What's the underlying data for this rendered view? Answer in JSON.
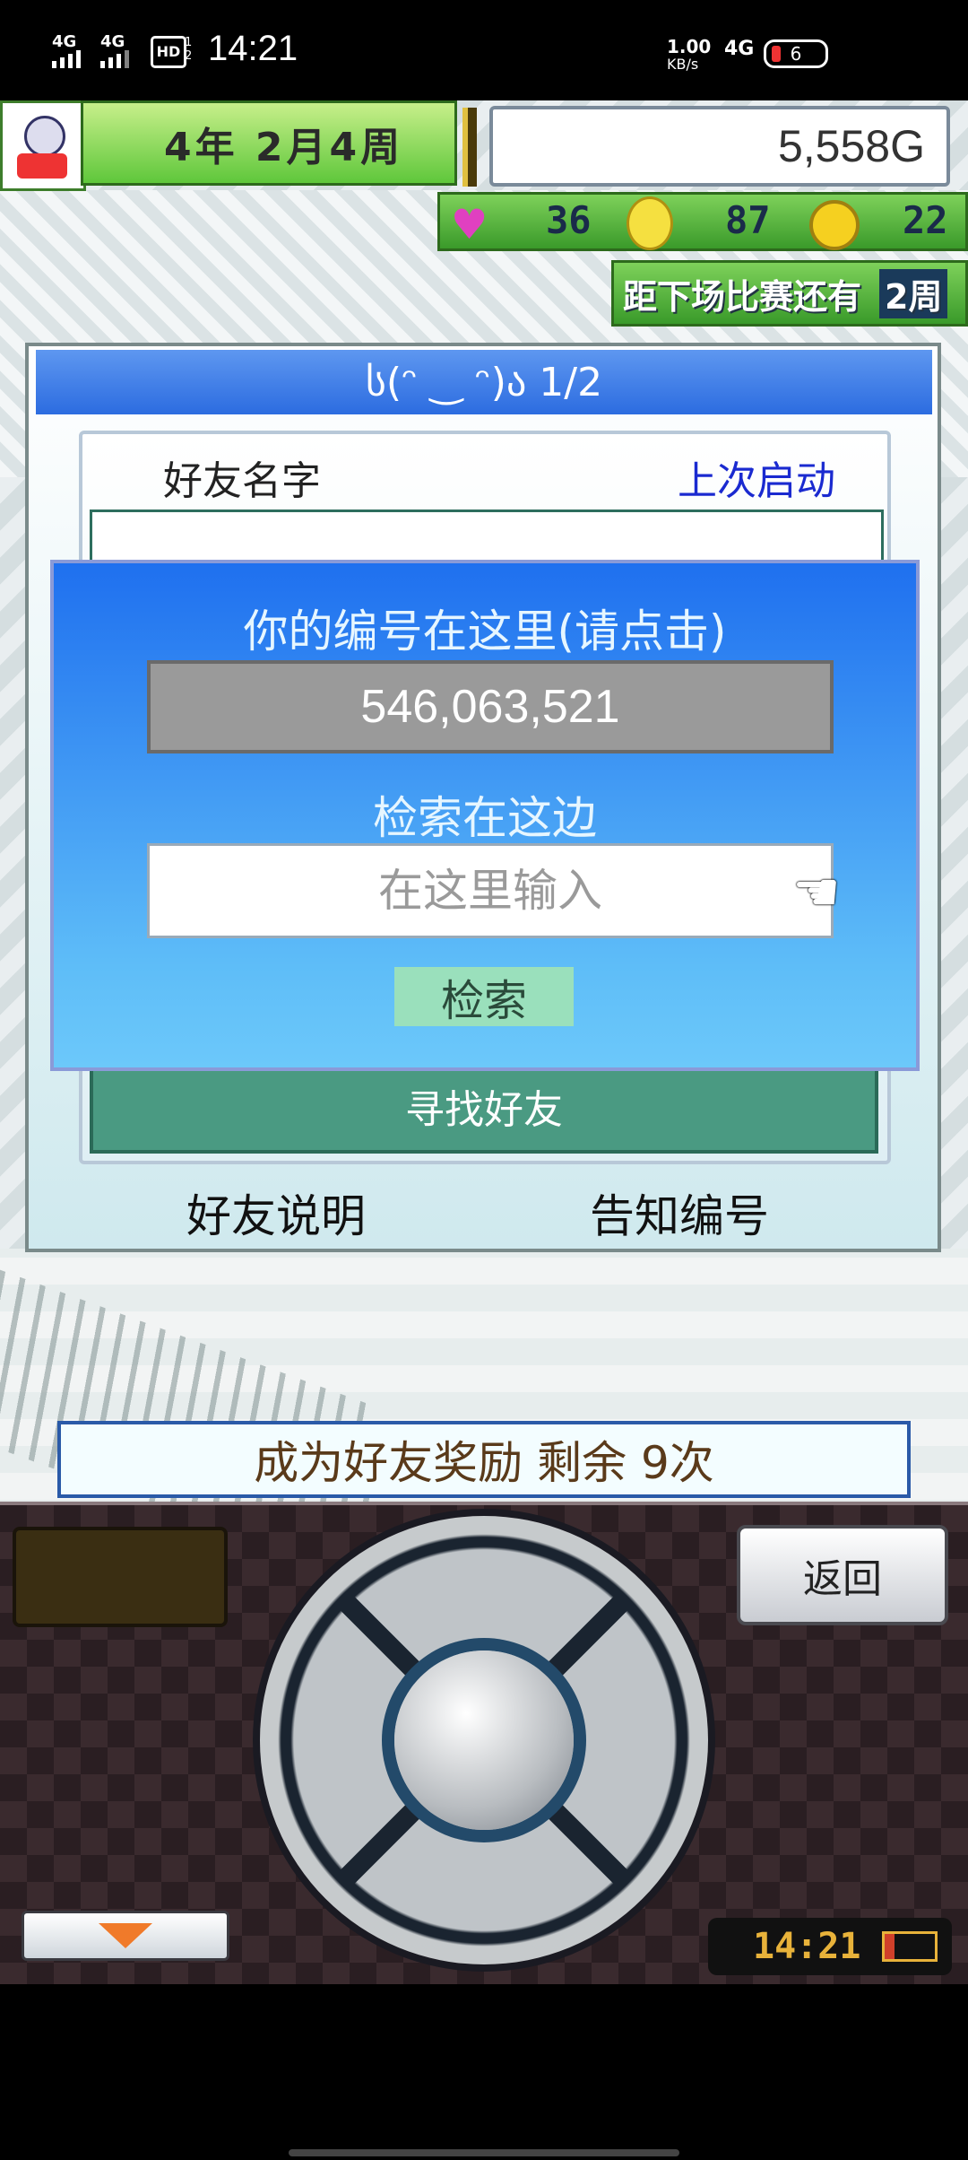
{
  "status_bar": {
    "time": "14:21",
    "sim1": "4G",
    "sim2": "4G",
    "hd": "HD",
    "hd_sub": "1 2",
    "net_speed": "1.00",
    "net_unit": "KB/s",
    "net_type": "4G",
    "battery": "6"
  },
  "hud": {
    "date": "4年 2月4周",
    "gold": "5,558G",
    "hearts": "36",
    "ideas": "87",
    "coins": "22",
    "next_match_label": "距下场比赛还有",
    "next_match_weeks": "2周"
  },
  "dialog": {
    "title": "ს(ᵔ ‿ ᵔ)ა 1/2",
    "col_name": "好友名字",
    "col_last": "上次启动",
    "find_friend": "寻找好友",
    "friend_help": "好友说明",
    "tell_id": "告知编号"
  },
  "overlay": {
    "id_label": "你的编号在这里(请点击)",
    "id_value": "546,063,521",
    "search_label": "检索在这边",
    "search_placeholder": "在这里输入",
    "search_button": "检索"
  },
  "reward": {
    "text": "成为好友奖励 剩余 9次"
  },
  "controller": {
    "back": "返回",
    "clock": "14:21"
  },
  "colors": {
    "overlay_top": "#1f70ef",
    "overlay_bottom": "#6cc8fa",
    "hud_green": "#5fc73b",
    "find_button": "#4a9a82"
  }
}
